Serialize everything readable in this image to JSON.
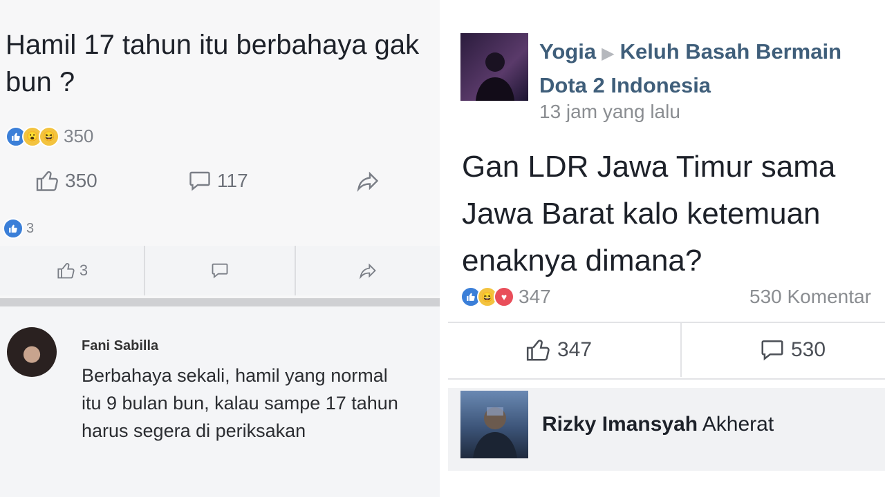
{
  "left": {
    "question": "Hamil 17 tahun itu berbahaya gak bun ?",
    "reaction_count": "350",
    "actions": {
      "likes": "350",
      "comments": "117"
    },
    "sub": {
      "reaction_count": "3",
      "likes": "3"
    },
    "comment": {
      "author": "Fani Sabilla",
      "text": "Berbahaya sekali, hamil yang normal itu 9 bulan bun, kalau sampe 17 tahun harus segera di periksakan"
    }
  },
  "right": {
    "author": "Yogia",
    "group": "Keluh Basah Bermain Dota 2 Indonesia",
    "time": "13 jam yang lalu",
    "question": "Gan LDR Jawa Timur sama Jawa Barat kalo ketemuan enaknya dimana?",
    "reaction_count": "347",
    "comments_label": "530 Komentar",
    "actions": {
      "likes": "347",
      "comments": "530"
    },
    "reply": {
      "author": "Rizky Imansyah",
      "text": "Akherat"
    }
  },
  "colors": {
    "like_blue": "#3b7fd8",
    "author_link": "#3f5e7a",
    "muted": "#8a8d91"
  },
  "icons": [
    "like-reaction-icon",
    "wow-reaction-icon",
    "haha-reaction-icon",
    "love-reaction-icon",
    "thumbs-up-icon",
    "comment-bubble-icon",
    "share-arrow-icon",
    "play-arrow-icon"
  ]
}
